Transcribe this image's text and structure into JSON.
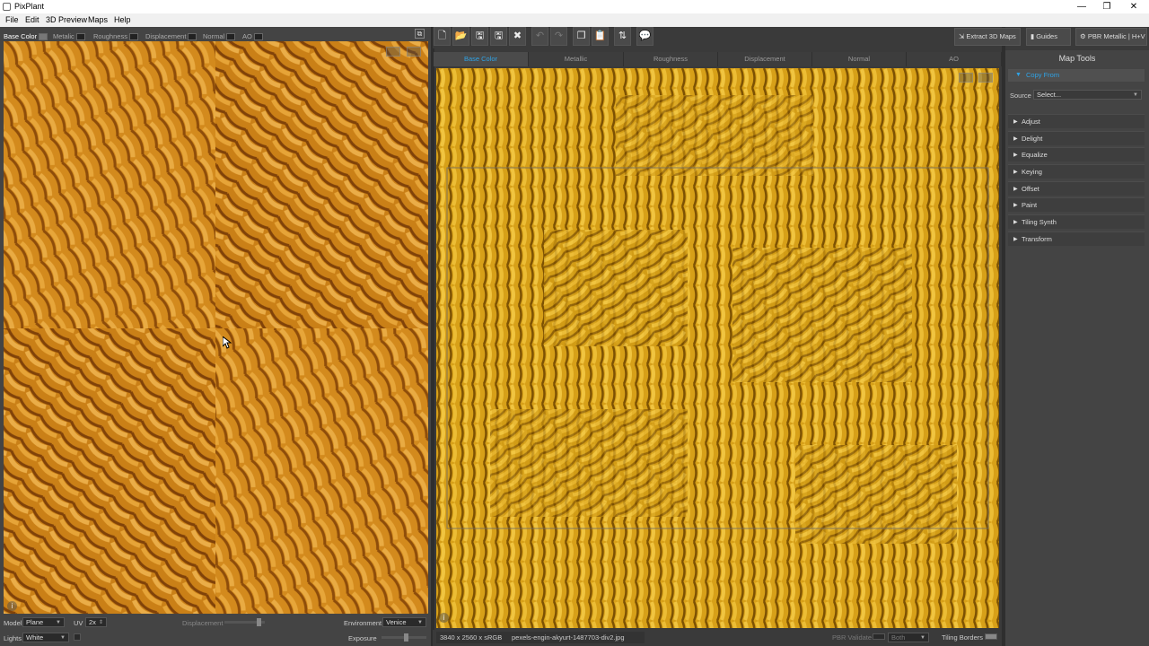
{
  "window": {
    "title": "PixPlant",
    "minimize": "—",
    "maximize": "❐",
    "close": "✕"
  },
  "menu": [
    "File",
    "Edit",
    "3D Preview",
    "Maps",
    "Help"
  ],
  "preview_channels": [
    {
      "label": "Base Color",
      "active": true
    },
    {
      "label": "Metalic",
      "active": false
    },
    {
      "label": "Roughness",
      "active": false
    },
    {
      "label": "Displacement",
      "active": false
    },
    {
      "label": "Normal",
      "active": false
    },
    {
      "label": "AO",
      "active": false
    }
  ],
  "bottom_left": {
    "model_label": "Model",
    "model_value": "Plane",
    "uv_label": "UV",
    "uv_value": "2x",
    "displacement_label": "Displacement",
    "environment_label": "Environment",
    "environment_value": "Venice",
    "lights_label": "Lights",
    "lights_value": "White",
    "exposure_label": "Exposure",
    "displacement_level": 0.9,
    "exposure_level": 0.55
  },
  "toolbar": {
    "icons": [
      "new-file-icon",
      "open-icon",
      "save-icon",
      "save-as-icon",
      "close-icon",
      "undo-icon",
      "redo-icon",
      "copy-icon",
      "paste-icon",
      "swap-icon",
      "comment-icon"
    ]
  },
  "map_tabs": [
    "Base Color",
    "Metallic",
    "Roughness",
    "Displacement",
    "Normal",
    "AO"
  ],
  "active_tab": "Base Color",
  "status": {
    "resolution": "3840 x 2560 x sRGB",
    "filename": "pexels-engin-akyurt-1487703-div2.jpg",
    "pbr_validate": "PBR Validate",
    "both": "Both",
    "tiling_borders": "Tiling Borders"
  },
  "top_right": {
    "extract": "Extract 3D Maps",
    "guides": "Guides",
    "mode": "PBR Metallic | H+V"
  },
  "map_tools": {
    "title": "Map Tools",
    "copy_from": "Copy From",
    "source_label": "Source",
    "source_value": "Select...",
    "tools": [
      "Adjust",
      "Delight",
      "Equalize",
      "Keying",
      "Offset",
      "Paint",
      "Tiling Synth",
      "Transform"
    ]
  },
  "colors": {
    "accent": "#2fa3e6",
    "yarn_left": "#c97a18",
    "yarn_main": "#c9960d"
  }
}
